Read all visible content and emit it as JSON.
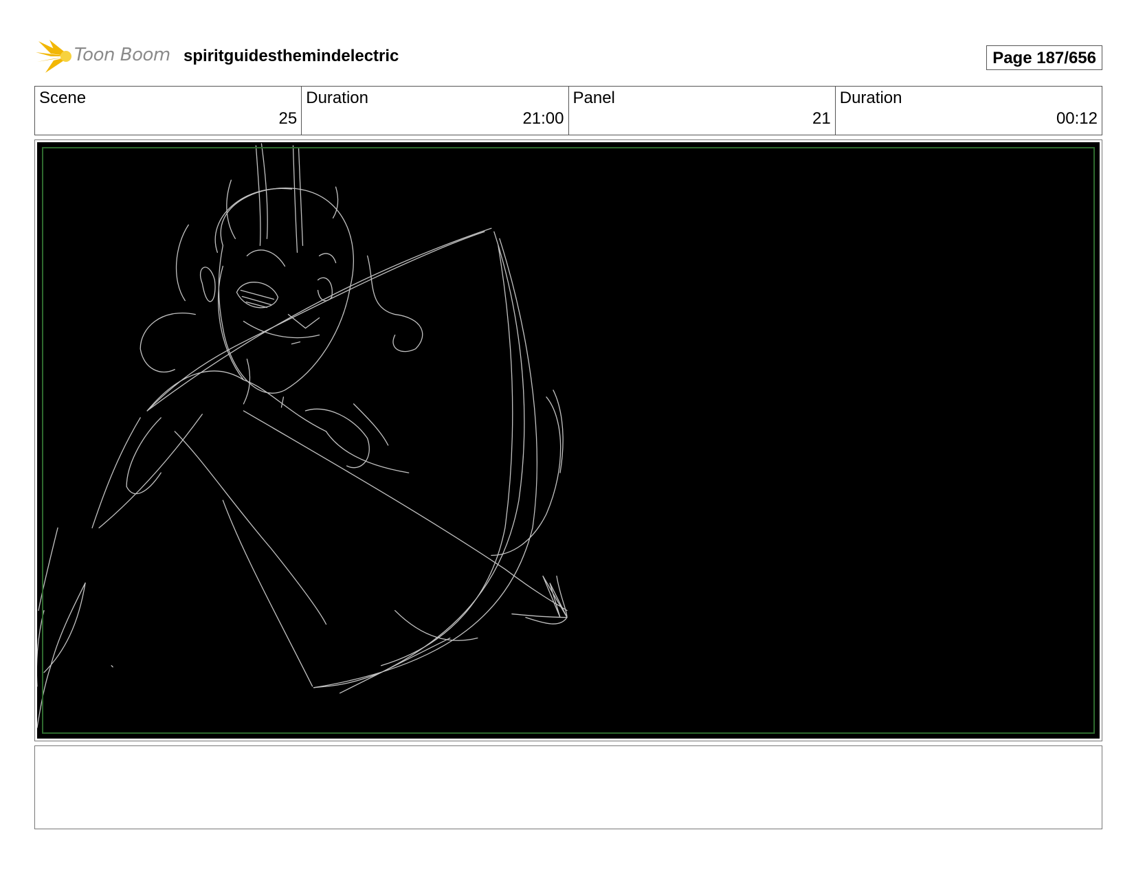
{
  "header": {
    "logo_text": "Toon Boom",
    "project_title": "spiritguidesthemindelectric",
    "page_label": "Page 187/656"
  },
  "info": [
    {
      "label": "Scene",
      "value": "25"
    },
    {
      "label": "Duration",
      "value": "21:00"
    },
    {
      "label": "Panel",
      "value": "21"
    },
    {
      "label": "Duration",
      "value": "00:12"
    }
  ],
  "panel": {
    "background_color": "#000000",
    "safe_area_color": "#2e6a2e",
    "sketch_color": "#d9d9d9"
  },
  "notes": {
    "text": ""
  }
}
